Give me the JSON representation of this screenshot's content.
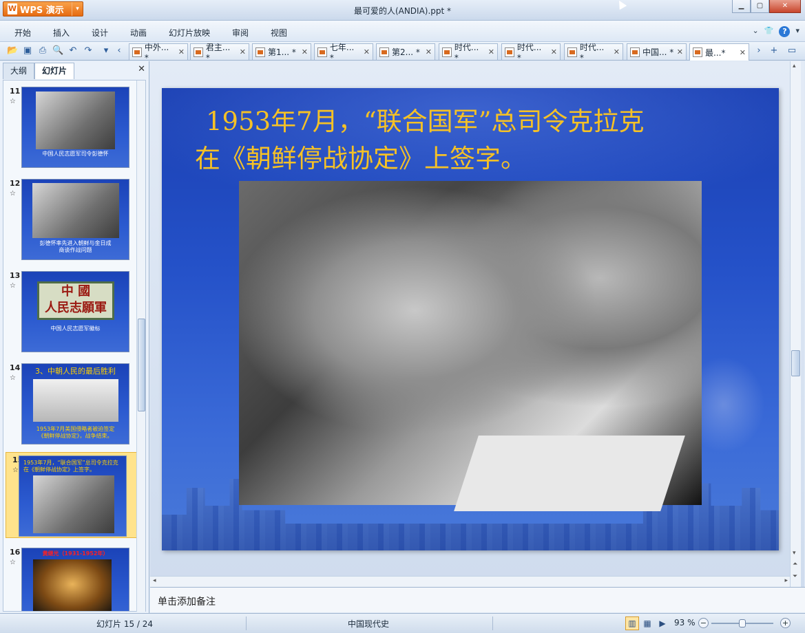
{
  "app": {
    "name": "WPS 演示",
    "logo_letter": "W",
    "window_title": "最可爱的人(ANDIA).ppt *"
  },
  "menu": [
    "开始",
    "插入",
    "设计",
    "动画",
    "幻灯片放映",
    "审阅",
    "视图"
  ],
  "doc_tabs": [
    "中外... *",
    "君主... *",
    "第1... *",
    "七年... *",
    "第2... *",
    "时代... *",
    "时代... *",
    "时代... *",
    "中国... *",
    "最...*"
  ],
  "left_pane": {
    "tabs": [
      "大纲",
      "幻灯片"
    ],
    "thumbnails": [
      {
        "num": "11",
        "caption": "中国人民志愿军司令彭德怀"
      },
      {
        "num": "12",
        "caption": "彭德怀率先进入朝鲜与金日成\n商谈作战问题"
      },
      {
        "num": "13",
        "sign": "中 國\n人民志願軍",
        "caption": "中国人民志愿军徽标"
      },
      {
        "num": "14",
        "heading": "3、中朝人民的最后胜利",
        "caption": "1953年7月美国侵略者被迫签定\n《朝鲜停战协定》，战争结束。"
      },
      {
        "num": "15",
        "caption": "1953年7月，“联合国军”总司令克拉克\n在《朝鲜停战协定》上签字。"
      },
      {
        "num": "16",
        "caption": "黄继光（1931-1952年）"
      }
    ]
  },
  "slide": {
    "title_line1": "1953年7月，“联合国军”总司令克拉克",
    "title_line2": "在《朝鲜停战协定》上签字。",
    "title_color": "#f5c126"
  },
  "notes_placeholder": "单击添加备注",
  "status": {
    "slide_counter": "幻灯片 15 / 24",
    "theme": "中国现代史",
    "zoom": "93 %"
  }
}
